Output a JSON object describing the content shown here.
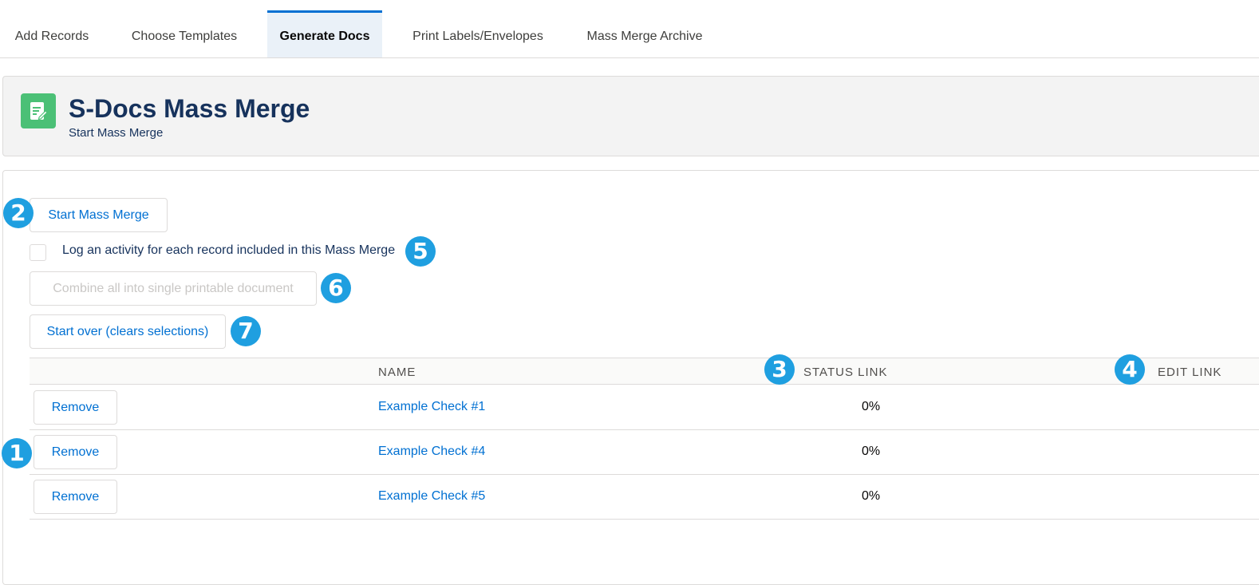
{
  "tabs": [
    {
      "label": "Add Records",
      "active": false
    },
    {
      "label": "Choose Templates",
      "active": false
    },
    {
      "label": "Generate Docs",
      "active": true
    },
    {
      "label": "Print Labels/Envelopes",
      "active": false
    },
    {
      "label": "Mass Merge Archive",
      "active": false
    }
  ],
  "header": {
    "title": "S-Docs Mass Merge",
    "subtitle": "Start Mass Merge",
    "icon": "document-edit-icon",
    "icon_color": "#4bc076"
  },
  "actions": {
    "start_label": "Start Mass Merge",
    "log_activity_label": "Log an activity for each record included in this Mass Merge",
    "log_activity_checked": false,
    "combine_label": "Combine all into single printable document",
    "combine_disabled": true,
    "start_over_label": "Start over (clears selections)"
  },
  "table": {
    "headers": {
      "name": "NAME",
      "status": "STATUS LINK",
      "edit": "EDIT LINK"
    },
    "rows": [
      {
        "remove_label": "Remove",
        "name": "Example Check #1",
        "status": "0%"
      },
      {
        "remove_label": "Remove",
        "name": "Example Check #4",
        "status": "0%"
      },
      {
        "remove_label": "Remove",
        "name": "Example Check #5",
        "status": "0%"
      }
    ]
  },
  "callouts": {
    "c1": "1",
    "c2": "2",
    "c3": "3",
    "c4": "4",
    "c5": "5",
    "c6": "6",
    "c7": "7"
  },
  "colors": {
    "accent": "#0070d2",
    "badge": "#1f9fe0",
    "title": "#16325c"
  }
}
